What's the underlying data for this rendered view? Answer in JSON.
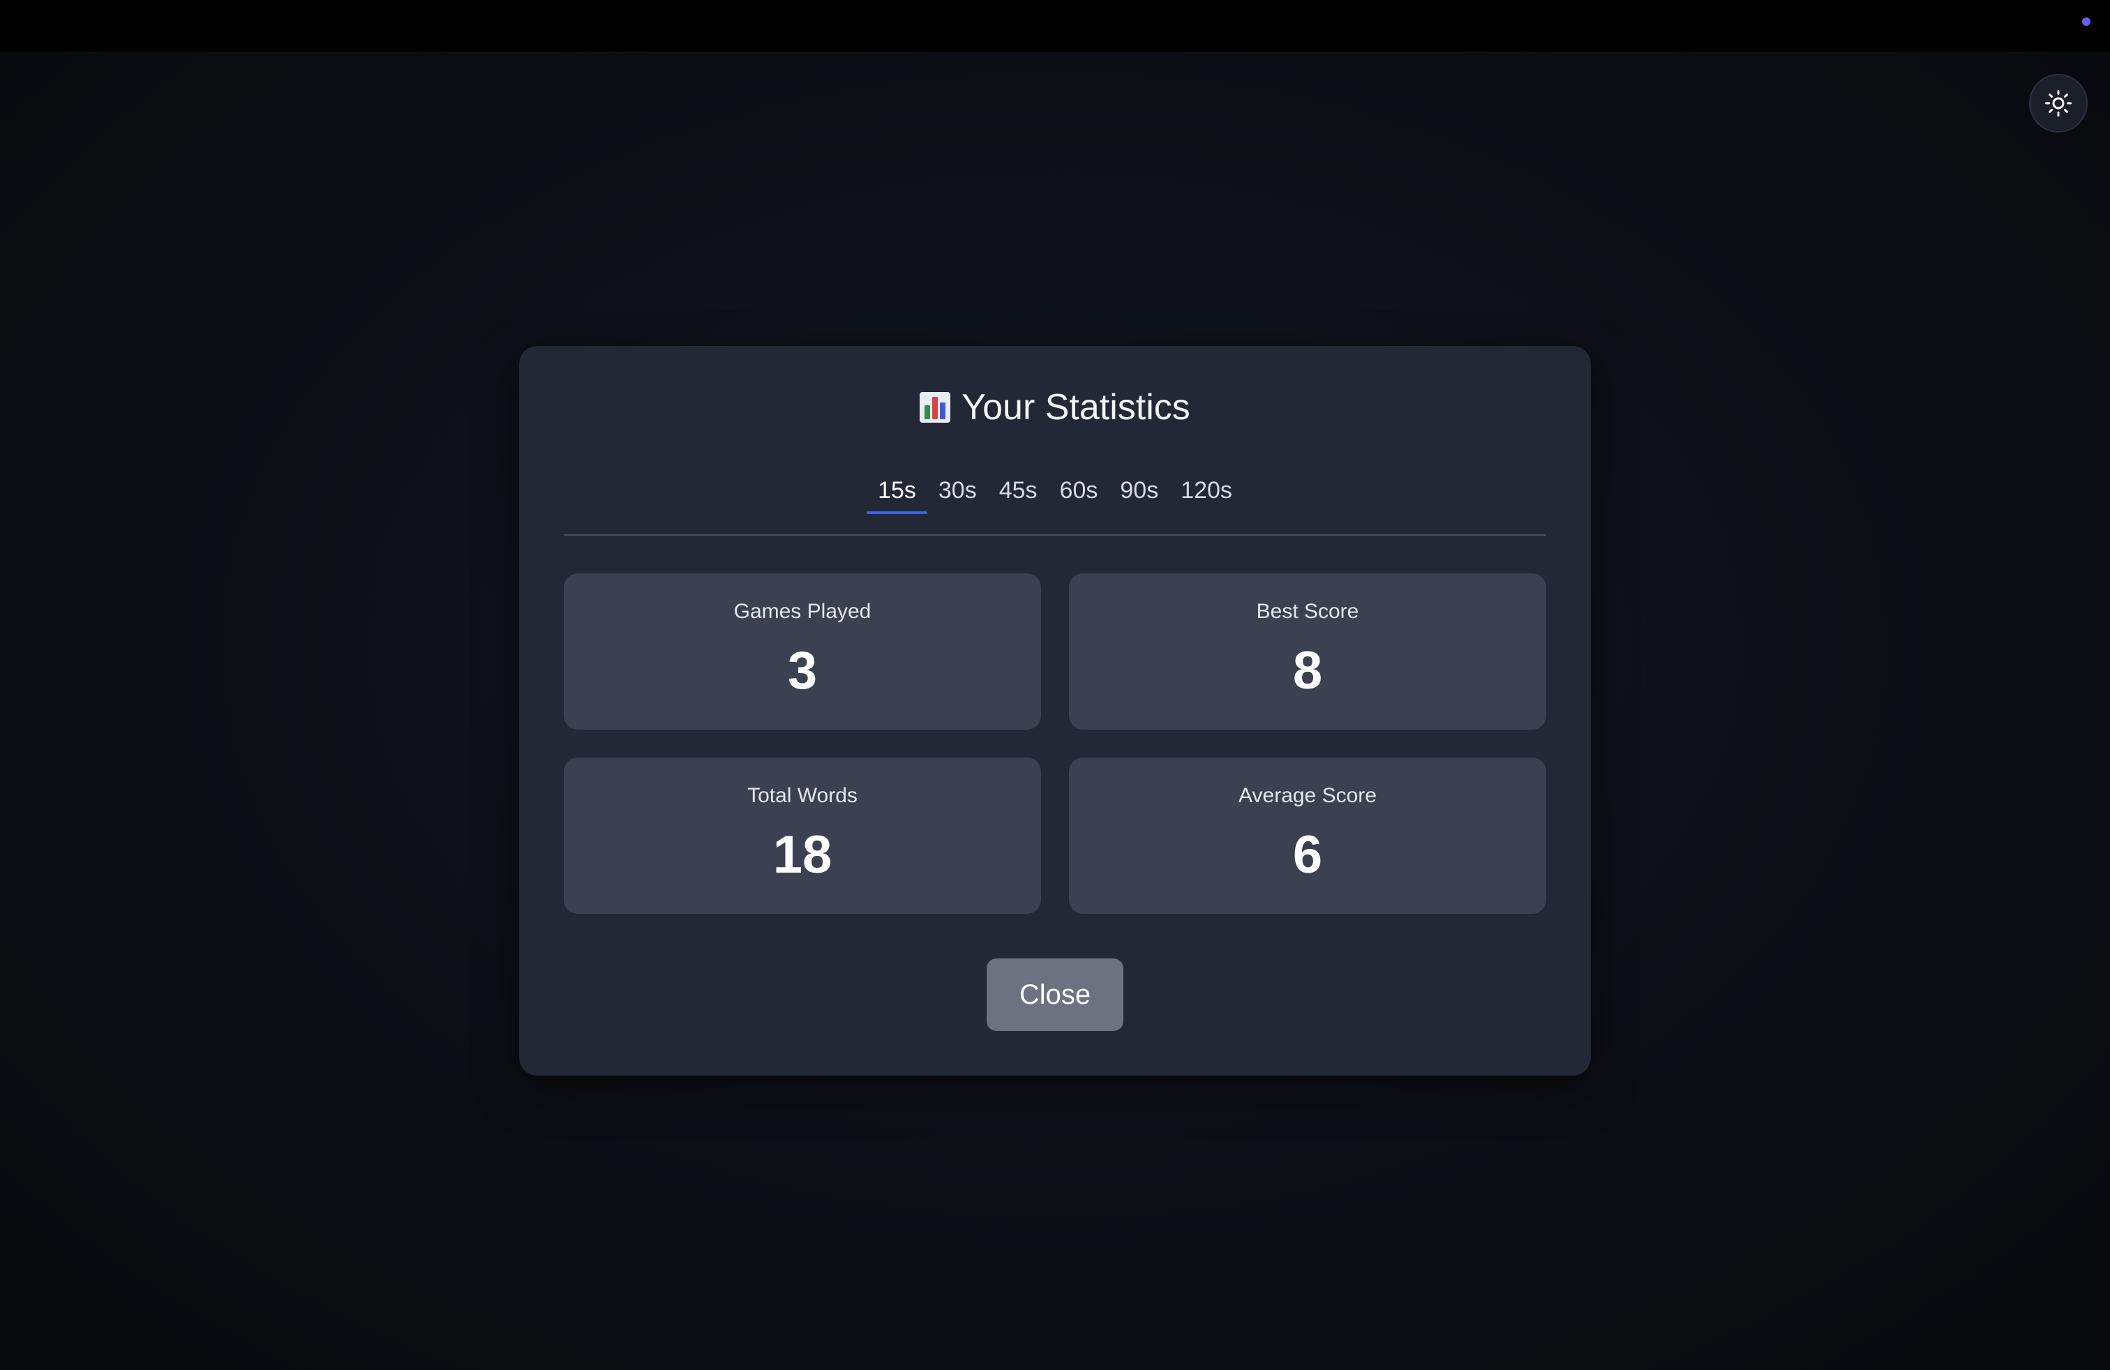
{
  "modal": {
    "title": "Your Statistics",
    "title_icon": "bar-chart-icon",
    "tabs": [
      {
        "label": "15s",
        "active": true
      },
      {
        "label": "30s",
        "active": false
      },
      {
        "label": "45s",
        "active": false
      },
      {
        "label": "60s",
        "active": false
      },
      {
        "label": "90s",
        "active": false
      },
      {
        "label": "120s",
        "active": false
      }
    ],
    "stats": [
      {
        "label": "Games Played",
        "value": "3"
      },
      {
        "label": "Best Score",
        "value": "8"
      },
      {
        "label": "Total Words",
        "value": "18"
      },
      {
        "label": "Average Score",
        "value": "6"
      }
    ],
    "close_label": "Close"
  },
  "theme_toggle": {
    "icon": "sun-icon"
  },
  "colors": {
    "accent": "#3b64e0",
    "status_dot": "#6a5cf6",
    "modal_bg": "#222835",
    "card_bg": "#3b4150"
  }
}
